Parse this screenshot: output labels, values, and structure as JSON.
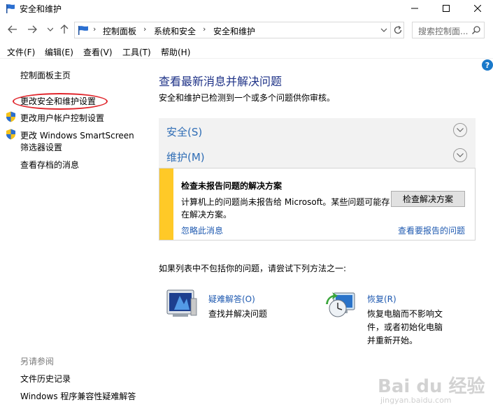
{
  "window": {
    "title": "安全和维护",
    "icon": "flag-icon"
  },
  "address": {
    "crumbs": [
      "控制面板",
      "系统和安全",
      "安全和维护"
    ],
    "search_placeholder": "搜索控制面..."
  },
  "menu": [
    "文件(F)",
    "编辑(E)",
    "查看(V)",
    "工具(T)",
    "帮助(H)"
  ],
  "left_pane": {
    "home": "控制面板主页",
    "links": [
      "更改安全和维护设置",
      "更改用户帐户控制设置",
      "更改 Windows SmartScreen",
      "筛选器设置",
      "查看存档的消息"
    ],
    "see_also_title": "另请参阅",
    "see_also": [
      "文件历史记录",
      "Windows 程序兼容性疑难解答"
    ]
  },
  "main": {
    "title": "查看最新消息并解决问题",
    "subtitle": "安全和维护已检测到一个或多个问题供你审核。",
    "sections": [
      "安全(S)",
      "维护(M)"
    ],
    "alert": {
      "title": "检查未报告问题的解决方案",
      "body": "计算机上的问题尚未报告给 Microsoft。某些问题可能存在解决方案。",
      "button": "检查解决方案",
      "ignore": "忽略此消息",
      "view_reports": "查看要报告的问题",
      "accent_color": "#ffc927"
    },
    "hint": "如果列表中不包括你的问题，请尝试下列方法之一:",
    "tools": [
      {
        "title": "疑难解答(O)",
        "desc": "查找并解决问题"
      },
      {
        "title": "恢复(R)",
        "desc": "恢复电脑而不影响文件，或者初始化电脑并重新开始。"
      }
    ]
  },
  "watermark": {
    "text": "Bai du 经验",
    "sub": "jingyan.baidu.com"
  }
}
